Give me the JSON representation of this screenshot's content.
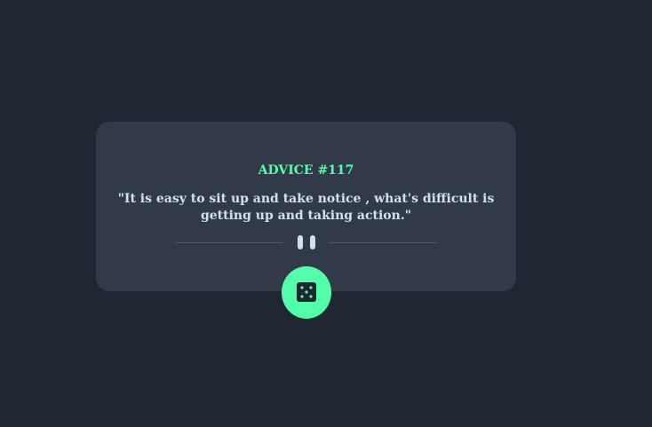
{
  "card": {
    "advice_id": "ADVICE #117",
    "quote": "\"It is easy to sit up and take notice , what's difficult is getting up and taking action.\""
  },
  "divider": {
    "icon": "pause-icon"
  },
  "button": {
    "icon": "dice-icon"
  },
  "colors": {
    "background": "#202632",
    "card": "#323a4a",
    "accent": "#52ffa8",
    "text": "#cee3e9",
    "divider": "#4f5d74"
  }
}
